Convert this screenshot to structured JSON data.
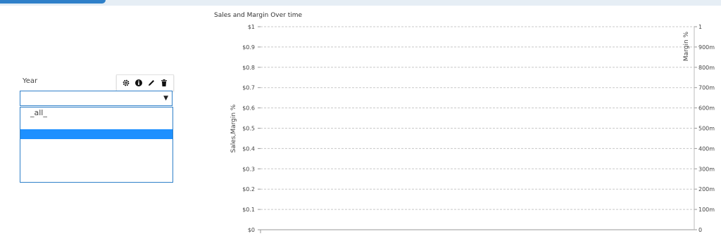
{
  "filter": {
    "label": "Year",
    "selected_value": "",
    "options": [
      "_all_",
      ""
    ]
  },
  "toolbar": {
    "icons": [
      "gear-icon",
      "info-icon",
      "pencil-icon",
      "trash-icon"
    ]
  },
  "chart_data": {
    "type": "line",
    "title": "Sales and Margin Over time",
    "ylabel": "Sales,Margin %",
    "y2label": "Margin %",
    "ylim": [
      0,
      1
    ],
    "y2lim": [
      0,
      1
    ],
    "yticks": [
      "$0",
      "$0.1",
      "$0.2",
      "$0.3",
      "$0.4",
      "$0.5",
      "$0.6",
      "$0.7",
      "$0.8",
      "$0.9",
      "$1"
    ],
    "y2ticks": [
      "0",
      "100m",
      "200m",
      "300m",
      "400m",
      "500m",
      "600m",
      "700m",
      "800m",
      "900m",
      "1"
    ],
    "grid": true,
    "series": []
  },
  "colors": {
    "accent": "#2f80c9",
    "selected_row": "#1e90ff"
  }
}
